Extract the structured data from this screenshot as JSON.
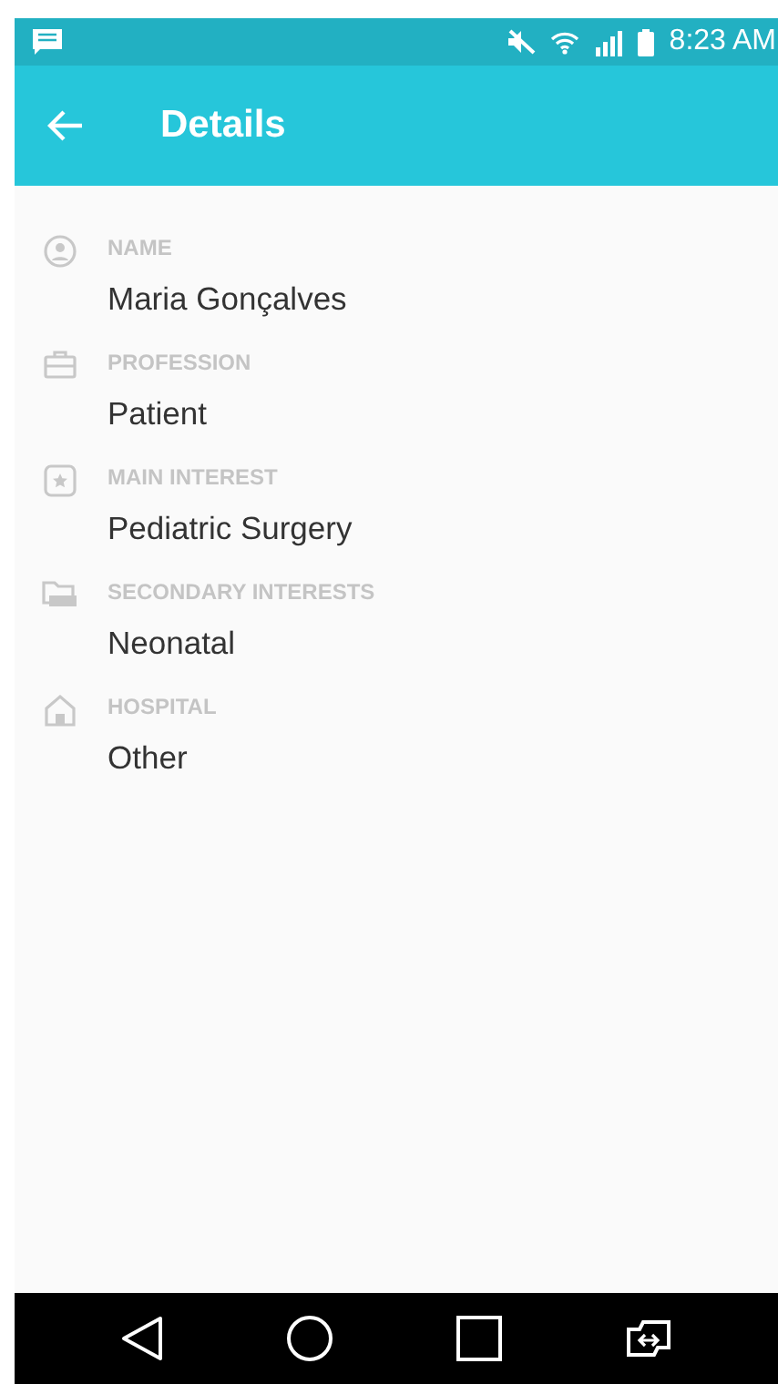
{
  "status_bar": {
    "time": "8:23 AM"
  },
  "app_bar": {
    "title": "Details"
  },
  "fields": [
    {
      "kind": "person",
      "label": "NAME",
      "value": "Maria Gonçalves"
    },
    {
      "kind": "briefcase",
      "label": "PROFESSION",
      "value": "Patient"
    },
    {
      "kind": "star",
      "label": "MAIN INTEREST",
      "value": "Pediatric Surgery"
    },
    {
      "kind": "folder",
      "label": "SECONDARY INTERESTS",
      "value": "Neonatal"
    },
    {
      "kind": "home",
      "label": "HOSPITAL",
      "value": "Other"
    }
  ]
}
